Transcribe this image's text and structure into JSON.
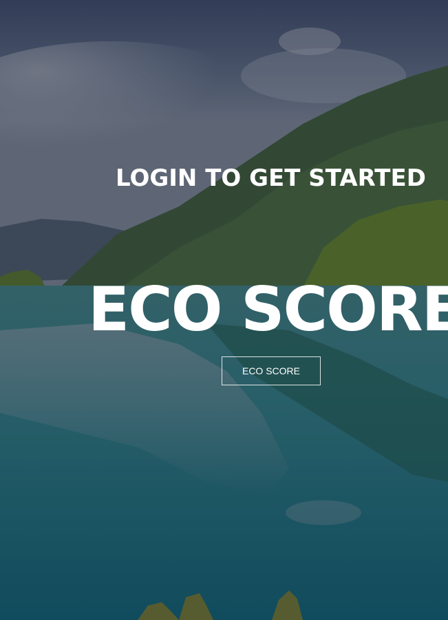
{
  "hero": {
    "heading": "LOGIN TO GET STARTED",
    "brand_title": "ECO SCORE",
    "cta_label": "ECO SCORE",
    "text_color": "#ffffff",
    "overlay_color": "#141828"
  }
}
